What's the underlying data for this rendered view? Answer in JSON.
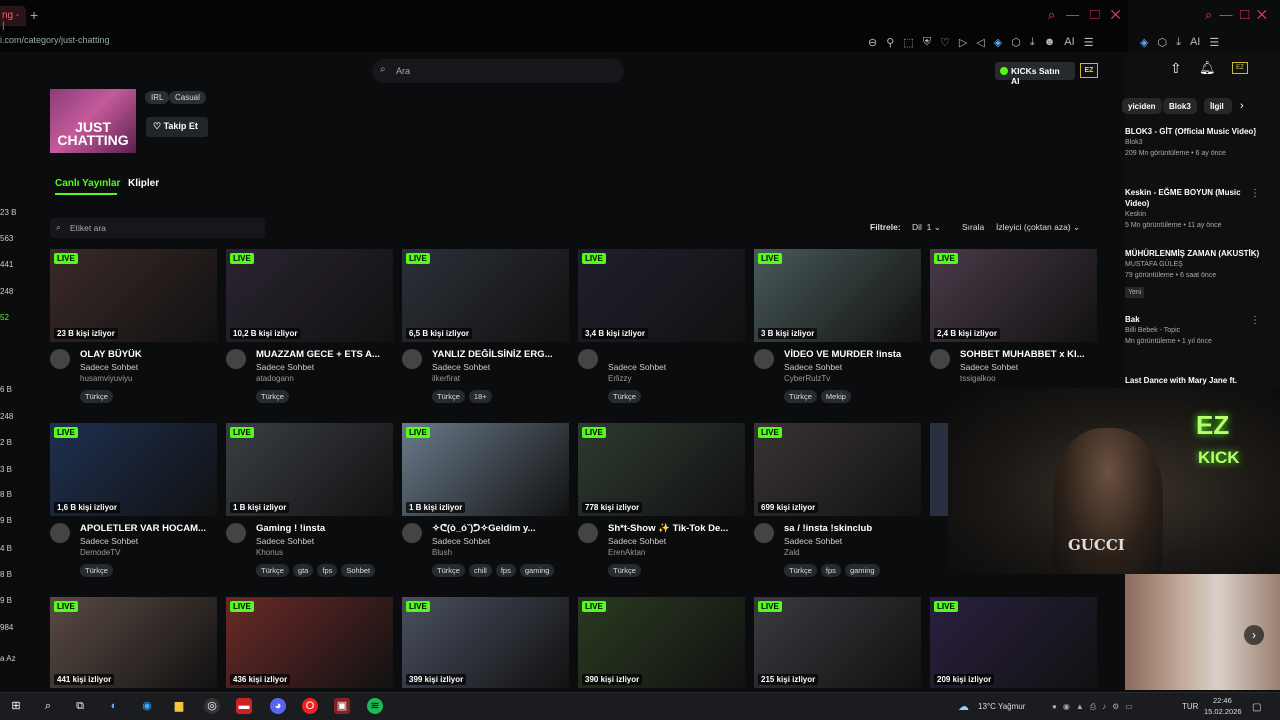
{
  "browser": {
    "tab_label": "ng - |",
    "new_tab": "+",
    "url": "i.com/category/just-chatting",
    "extensions_ai": "AI",
    "yt_ai": "AI"
  },
  "header": {
    "search_placeholder": "Ara",
    "kicks_button": "KICKs Satın Al",
    "ez_logo": "EZ"
  },
  "category": {
    "thumb_text": "JUST CHATTING",
    "tags": [
      "IRL",
      "Casual"
    ],
    "follow_label": "Takip Et"
  },
  "tabs": {
    "live": "Canlı Yayınlar",
    "clips": "Klipler"
  },
  "filters": {
    "tag_search_placeholder": "Etiket ara",
    "filter_label": "Filtrele:",
    "lang_label": "Dil",
    "lang_count": "1",
    "sort_label": "Sırala",
    "sort_value": "İzleyici (çoktan aza)"
  },
  "left_numbers": [
    "23 B",
    "563",
    "441",
    "248",
    "52",
    "6 B",
    "248",
    "2 B",
    "3 B",
    "8 B",
    "9 B",
    "4 B",
    "8 B",
    "9 B",
    "984",
    "a Az"
  ],
  "live_badge": "LIVE",
  "streams": [
    {
      "viewers": "23 B kişi izliyor",
      "title": "OLAY BÜYÜK",
      "category": "Sadece Sohbet",
      "streamer": "husamviyuviyu",
      "tags": [
        "Türkçe"
      ],
      "color": "#3a2a28"
    },
    {
      "viewers": "10,2 B kişi izliyor",
      "title": "MUAZZAM GECE + ETS A...",
      "category": "Sadece Sohbet",
      "streamer": "atadogann",
      "tags": [
        "Türkçe"
      ],
      "color": "#2a2430"
    },
    {
      "viewers": "6,5 B kişi izliyor",
      "title": "YANLIZ DEĞİLSİNİZ ERG...",
      "category": "Sadece Sohbet",
      "streamer": "ilkerfirat",
      "tags": [
        "Türkçe",
        "18+"
      ],
      "color": "#2c3038"
    },
    {
      "viewers": "3,4 B kişi izliyor",
      "title": "",
      "category": "Sadece Sohbet",
      "streamer": "Erlizzy",
      "tags": [
        "Türkçe"
      ],
      "color": "#20202e"
    },
    {
      "viewers": "3 B kişi izliyor",
      "title": "VİDEO VE MURDER !insta",
      "category": "Sadece Sohbet",
      "streamer": "CyberRulzTv",
      "tags": [
        "Türkçe",
        "Mekip"
      ],
      "color": "#4a5a5a"
    },
    {
      "viewers": "2,4 B kişi izliyor",
      "title": "SOHBET MUHABBET x KI...",
      "category": "Sadece Sohbet",
      "streamer": "tssigalkoo",
      "tags": [],
      "color": "#4a3a48"
    },
    {
      "viewers": "1,6 B kişi izliyor",
      "title": "APOLETLER VAR HOCAM...",
      "category": "Sadece Sohbet",
      "streamer": "DemodeTV",
      "tags": [
        "Türkçe"
      ],
      "color": "#1e3050"
    },
    {
      "viewers": "1 B kişi izliyor",
      "title": "Gaming ! !insta",
      "category": "Sadece Sohbet",
      "streamer": "Khonus",
      "tags": [
        "Türkçe",
        "gta",
        "fps",
        "Sohbet"
      ],
      "color": "#3a3e44"
    },
    {
      "viewers": "1 B kişi izliyor",
      "title": "✧ᕦ(ò_óˇ)ᕤ✧Geldim y...",
      "category": "Sadece Sohbet",
      "streamer": "Blush",
      "tags": [
        "Türkçe",
        "chill",
        "fps",
        "gaming"
      ],
      "color": "#6a7a8a"
    },
    {
      "viewers": "778 kişi izliyor",
      "title": "Sh*t-Show ✨ Tik-Tok De...",
      "category": "Sadece Sohbet",
      "streamer": "ErenAktan",
      "tags": [
        "Türkçe"
      ],
      "color": "#2e3a30"
    },
    {
      "viewers": "699 kişi izliyor",
      "title": "sa / !insta !skinclub",
      "category": "Sadece Sohbet",
      "streamer": "Zald",
      "tags": [
        "Türkçe",
        "fps",
        "gaming"
      ],
      "color": "#3a3434"
    },
    {
      "viewers": "441 kişi izliyor",
      "title": "",
      "category": "",
      "streamer": "",
      "tags": [],
      "color": "#5a4a44"
    },
    {
      "viewers": "436 kişi izliyor",
      "title": "",
      "category": "",
      "streamer": "",
      "tags": [],
      "color": "#6a2a28"
    },
    {
      "viewers": "399 kişi izliyor",
      "title": "",
      "category": "",
      "streamer": "",
      "tags": [],
      "color": "#4a5060"
    },
    {
      "viewers": "390 kişi izliyor",
      "title": "",
      "category": "",
      "streamer": "",
      "tags": [],
      "color": "#2a3a20"
    },
    {
      "viewers": "215 kişi izliyor",
      "title": "",
      "category": "",
      "streamer": "",
      "tags": [],
      "color": "#3a3a40"
    },
    {
      "viewers": "209 kişi izliyor",
      "title": "",
      "category": "",
      "streamer": "",
      "tags": [],
      "color": "#2a2040"
    }
  ],
  "youtube": {
    "chips": [
      "yiciden",
      "Blok3",
      "İlgil"
    ],
    "items": [
      {
        "title": "BLOK3 - GİT (Official Music Video)",
        "channel": "Blok3",
        "meta": "209 Mn görüntüleme • 6 ay önce"
      },
      {
        "title": "Keskin - EĞME BOYUN (Music Video)",
        "channel": "Keskin",
        "meta": "5 Mn görüntüleme • 11 ay önce"
      },
      {
        "title": "MÜHÜRLENMİŞ ZAMAN (AKUSTİK)",
        "channel": "MUSTAFA GÜLEŞ",
        "meta": "79 görüntüleme • 6 saat önce",
        "badge": "Yeni"
      },
      {
        "title": "Bak",
        "channel": "Billi Bebek - Topic",
        "meta": "Mn görüntüleme • 1 yıl önce"
      },
      {
        "title": "Last Dance with Mary Jane ft.",
        "channel": "",
        "meta": ""
      }
    ]
  },
  "webcam": {
    "neon_text": "EZ",
    "neon_sub": "KICK",
    "shirt": "GUCCI"
  },
  "taskbar": {
    "weather": "13°C Yağmur",
    "lang": "TUR",
    "time": "22:46",
    "date": "15.02.2026"
  }
}
